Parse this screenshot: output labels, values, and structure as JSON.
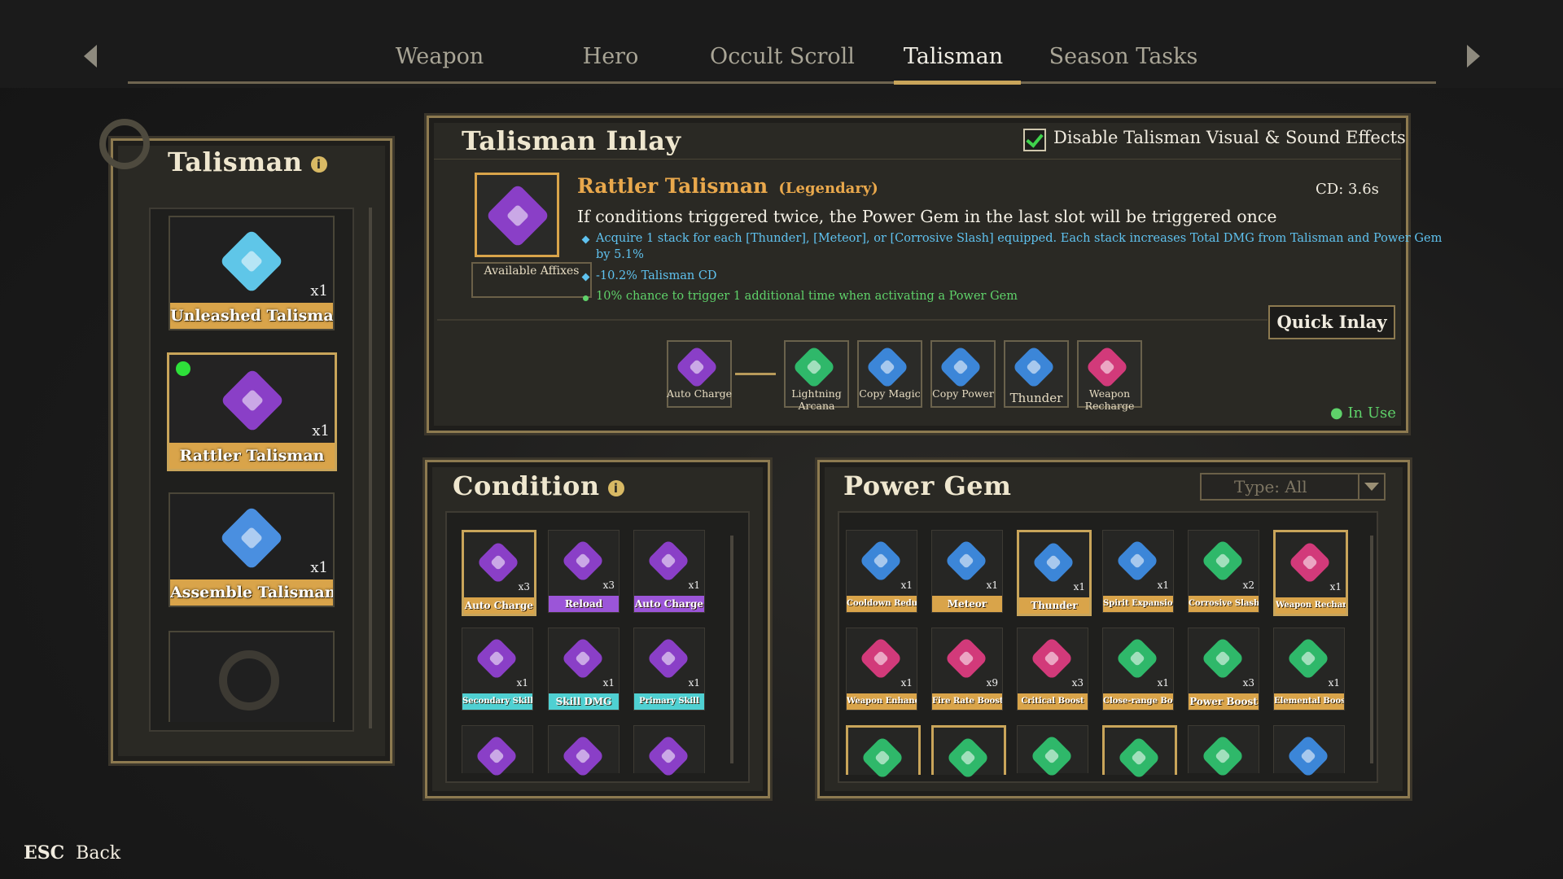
{
  "nav": {
    "tabs": [
      "Weapon",
      "Hero",
      "Occult Scroll",
      "Talisman",
      "Season Tasks"
    ],
    "active_tab": "Talisman"
  },
  "left_panel": {
    "title": "Talisman",
    "info_icon_text": "i",
    "talismans": [
      {
        "name": "Unleashed Talisman",
        "qty": "x1",
        "icon": "unleashed-talisman-icon",
        "color": "#5fc6e8"
      },
      {
        "name": "Rattler Talisman",
        "qty": "x1",
        "icon": "rattler-talisman-icon",
        "color": "#8a3fc7",
        "equipped": true
      },
      {
        "name": "Assemble Talisman",
        "qty": "x1",
        "icon": "assemble-talisman-icon",
        "color": "#4a8fe0"
      }
    ],
    "empty_slot_icon": "empty-talisman-emblem-icon"
  },
  "inlay": {
    "title": "Talisman Inlay",
    "disable_effects_label": "Disable Talisman Visual & Sound Effects",
    "disable_effects_checked": true,
    "talisman_name": "Rattler Talisman",
    "rarity": "(Legendary)",
    "cd_label": "CD:",
    "cd_value": "3.6s",
    "description": "If conditions triggered twice, the Power Gem in the last slot will be triggered once",
    "affixes": [
      {
        "text": "Acquire 1 stack for each [Thunder], [Meteor], or [Corrosive Slash] equipped. Each stack increases Total DMG from Talisman and Power Gem",
        "color": "blue"
      },
      {
        "text": "by 5.1%",
        "color": "blue"
      },
      {
        "text": "-10.2% Talisman CD",
        "color": "blue"
      },
      {
        "text": "10% chance to trigger 1 additional time when activating a Power Gem",
        "color": "green"
      }
    ],
    "available_affixes_label": "Available Affixes",
    "quick_inlay_label": "Quick Inlay",
    "in_use_label": "In Use",
    "slots": [
      {
        "label": "Auto Charge",
        "color": "#8a3fc7"
      },
      {
        "label": "Lightning Arcana",
        "color": "#2fb86a"
      },
      {
        "label": "Copy Magic",
        "color": "#3c86d8"
      },
      {
        "label": "Copy Power",
        "color": "#3c86d8"
      },
      {
        "label": "Thunder",
        "color": "#3c86d8"
      },
      {
        "label": "Weapon Recharge",
        "color": "#d23a7a"
      }
    ]
  },
  "condition": {
    "title": "Condition",
    "info_icon_text": "i",
    "items": [
      {
        "label": "Auto Charge",
        "qty": "x3",
        "tag": "gold",
        "selected": true
      },
      {
        "label": "Reload",
        "qty": "x3",
        "tag": "purple"
      },
      {
        "label": "Auto Charge",
        "qty": "x1",
        "tag": "purple"
      },
      {
        "label": "Secondary Skill",
        "qty": "x1",
        "tag": "cyan"
      },
      {
        "label": "Skill DMG",
        "qty": "x1",
        "tag": "cyan"
      },
      {
        "label": "Primary Skill",
        "qty": "x1",
        "tag": "cyan"
      },
      {
        "label": "",
        "qty": "",
        "tag": ""
      },
      {
        "label": "",
        "qty": "",
        "tag": ""
      },
      {
        "label": "",
        "qty": "",
        "tag": ""
      }
    ]
  },
  "power_gem": {
    "title": "Power Gem",
    "type_filter": "Type: All",
    "items": [
      {
        "label": "Cooldown Reduction",
        "qty": "x1",
        "color": "#3c86d8"
      },
      {
        "label": "Meteor",
        "qty": "x1",
        "color": "#3c86d8"
      },
      {
        "label": "Thunder",
        "qty": "x1",
        "color": "#3c86d8",
        "selected": true
      },
      {
        "label": "Spirit Expansion",
        "qty": "x1",
        "color": "#3c86d8"
      },
      {
        "label": "Corrosive Slash",
        "qty": "x2",
        "color": "#2fb86a"
      },
      {
        "label": "Weapon Recharge",
        "qty": "x1",
        "color": "#d23a7a",
        "selected": true
      },
      {
        "label": "Weapon Enhance",
        "qty": "x1",
        "color": "#d23a7a"
      },
      {
        "label": "Fire Rate Boost",
        "qty": "x9",
        "color": "#d23a7a"
      },
      {
        "label": "Critical Boost",
        "qty": "x3",
        "color": "#d23a7a"
      },
      {
        "label": "Close-range Boost",
        "qty": "x1",
        "color": "#2fb86a"
      },
      {
        "label": "Power Boost",
        "qty": "x3",
        "color": "#2fb86a"
      },
      {
        "label": "Elemental Boost",
        "qty": "x1",
        "color": "#2fb86a"
      },
      {
        "label": "",
        "qty": "",
        "color": "#2fb86a",
        "selected": true
      },
      {
        "label": "",
        "qty": "",
        "color": "#2fb86a",
        "selected": true
      },
      {
        "label": "",
        "qty": "",
        "color": "#2fb86a"
      },
      {
        "label": "",
        "qty": "",
        "color": "#2fb86a",
        "selected": true
      },
      {
        "label": "",
        "qty": "",
        "color": "#2fb86a"
      },
      {
        "label": "",
        "qty": "",
        "color": "#3c86d8"
      }
    ]
  },
  "footer": {
    "key": "ESC",
    "label": "Back"
  }
}
